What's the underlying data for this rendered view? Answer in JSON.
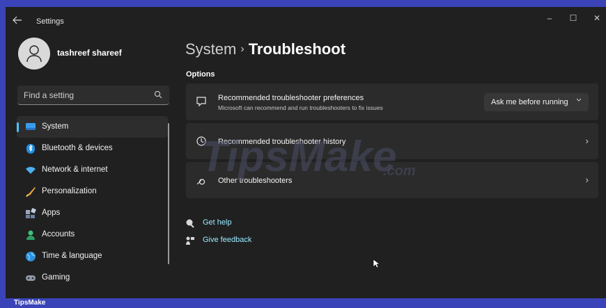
{
  "window": {
    "title": "Settings",
    "back_icon": "arrow-left-icon",
    "controls": {
      "minimize": "–",
      "maximize": "☐",
      "close": "✕"
    }
  },
  "profile": {
    "name": "tashreef shareef",
    "avatar_icon": "person-icon"
  },
  "search": {
    "placeholder": "Find a setting",
    "icon": "search-icon"
  },
  "nav": {
    "items": [
      {
        "label": "System",
        "icon": "monitor-icon",
        "active": true
      },
      {
        "label": "Bluetooth & devices",
        "icon": "bluetooth-icon"
      },
      {
        "label": "Network & internet",
        "icon": "wifi-icon"
      },
      {
        "label": "Personalization",
        "icon": "brush-icon"
      },
      {
        "label": "Apps",
        "icon": "apps-icon"
      },
      {
        "label": "Accounts",
        "icon": "account-icon"
      },
      {
        "label": "Time & language",
        "icon": "globe-icon"
      },
      {
        "label": "Gaming",
        "icon": "gamepad-icon"
      }
    ]
  },
  "breadcrumb": {
    "parent": "System",
    "separator": "›",
    "current": "Troubleshoot"
  },
  "options": {
    "section_label": "Options",
    "preferences": {
      "title": "Recommended troubleshooter preferences",
      "description": "Microsoft can recommend and run troubleshooters to fix issues",
      "dropdown_value": "Ask me before running",
      "icon": "chat-icon"
    },
    "history": {
      "title": "Recommended troubleshooter history",
      "icon": "history-icon",
      "chevron": "›"
    },
    "other": {
      "title": "Other troubleshooters",
      "icon": "wrench-icon",
      "chevron": "›"
    }
  },
  "links": {
    "help": {
      "label": "Get help",
      "icon": "help-icon"
    },
    "feedback": {
      "label": "Give feedback",
      "icon": "feedback-icon"
    }
  },
  "watermark": {
    "text": "TipsMake",
    "suffix": ".com"
  },
  "footer": {
    "label": "TipsMake"
  },
  "colors": {
    "accent": "#4cc2ff",
    "link": "#99ebff",
    "background": "#202020",
    "card": "#2b2b2b",
    "frame": "#3a44b8"
  }
}
